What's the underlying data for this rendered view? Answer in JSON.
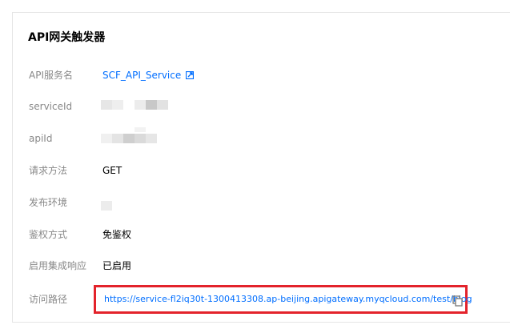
{
  "section": {
    "title": "API网关触发器"
  },
  "fields": {
    "service_name": {
      "label": "API服务名",
      "value": "SCF_API_Service",
      "icon": "external-link-icon"
    },
    "service_id": {
      "label": "serviceId"
    },
    "api_id": {
      "label": "apiId"
    },
    "method": {
      "label": "请求方法",
      "value": "GET"
    },
    "environment": {
      "label": "发布环境"
    },
    "auth": {
      "label": "鉴权方式",
      "value": "免鉴权"
    },
    "integration_response": {
      "label": "启用集成响应",
      "value": "已启用"
    },
    "access_path": {
      "label": "访问路径",
      "value": "https://service-fl2iq30t-1300413308.ap-beijing.apigateway.myqcloud.com/test/blog",
      "icon": "copy-icon"
    }
  },
  "colors": {
    "link": "#006eff",
    "highlight_border": "#e3232b",
    "label": "#888888"
  }
}
